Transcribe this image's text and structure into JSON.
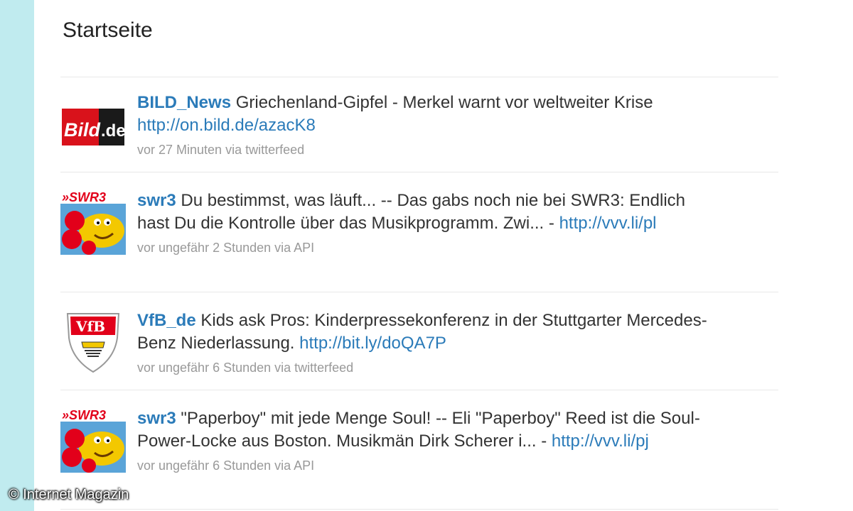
{
  "page": {
    "title": "Startseite"
  },
  "tweets": [
    {
      "user": "BILD_News",
      "text": "Griechenland-Gipfel - Merkel warnt vor weltweiter Krise",
      "link": "http://on.bild.de/azacK8",
      "link_suffix": "",
      "meta": "vor 27 Minuten via twitterfeed",
      "avatar": "bild-de-logo"
    },
    {
      "user": "swr3",
      "text": "Du bestimmst, was läuft... -- Das gabs noch nie bei SWR3: Endlich hast Du die Kontrolle über das Musikprogramm. Zwi... -",
      "link": "http://vvv.li/pl",
      "link_suffix": "",
      "meta": "vor ungefähr 2 Stunden via API",
      "avatar": "swr3-logo"
    },
    {
      "user": "VfB_de",
      "text": "Kids ask Pros: Kinderpressekonferenz in der Stuttgarter Mercedes-Benz Niederlassung.",
      "link": "http://bit.ly/doQA7P",
      "link_suffix": "",
      "meta": "vor ungefähr 6 Stunden via twitterfeed",
      "avatar": "vfb-crest"
    },
    {
      "user": "swr3",
      "text": "\"Paperboy\" mit jede Menge Soul! -- Eli \"Paperboy\" Reed ist die Soul-Power-Locke aus Boston. Musikmän Dirk Scherer i... -",
      "link": "http://vvv.li/pj",
      "link_suffix": "",
      "meta": "vor ungefähr 6 Stunden via API",
      "avatar": "swr3-logo"
    }
  ],
  "watermark": "© Internet Magazin",
  "colors": {
    "sidebar": "#c0ebef",
    "link": "#2b7bb9",
    "text": "#333333",
    "meta": "#999999",
    "bild_red": "#d9121b",
    "swr3_red": "#e2001a",
    "vfb_red": "#e2001a"
  }
}
